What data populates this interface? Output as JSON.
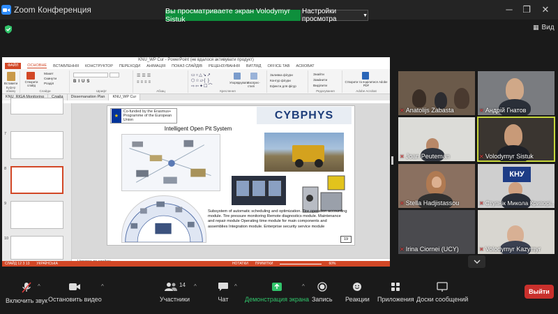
{
  "window": {
    "title": "Zoom Конференция"
  },
  "share_banner": {
    "text": "Вы просматриваете экран Volodymyr Sistuk",
    "view_options": "Настройки просмотра"
  },
  "view_button": "Вид",
  "ppt": {
    "window_title": "KNU_WP Cur - PowerPoint (не вдалося активувати продукт)",
    "tabs": [
      "ФАЙЛ",
      "ОСНОВНЕ",
      "ВСТАВЛЕННЯ",
      "КОНСТРУКТОР",
      "ПЕРЕХОДИ",
      "АНІМАЦІЯ",
      "ПОКАЗ СЛАЙДІВ",
      "РЕЦЕНЗУВАННЯ",
      "ВИГЛЯД",
      "OFFICE TAB",
      "ACROBAT"
    ],
    "ribbon": {
      "paste": "Вставити",
      "clipboard": "Буфер обміну",
      "new_slide": "Створити слайд",
      "slides": "Слайди",
      "layout": "Макет",
      "reset": "Скинути",
      "section": "Розділ",
      "font": "Шрифт",
      "paragraph": "Абзац",
      "arrange": "Упорядкувати",
      "quick_styles": "Експрес-стилі",
      "drawing": "Креслення",
      "fill": "Заливка фігури",
      "outline": "Контур фігури",
      "effects": "Ефекти для фігур",
      "find": "Знайти",
      "replace": "Замінити",
      "select": "Виділити",
      "editing": "Редагування",
      "adobe": "Створити та поділитися Adobe PDF",
      "adobe_group": "Adobe Acrobat"
    },
    "doc_tabs": [
      "KNU_RIGA Monitoring",
      "Слайд",
      "Dissemanation Plan",
      "KNU_WP Cur"
    ],
    "thumb_numbers": [
      "7",
      "8",
      "9",
      "10"
    ],
    "slide": {
      "eu_text": "Co-funded by the Erasmus+ Programme of the European Union",
      "logo": "CYBPHYS",
      "title": "Intelligent Open Pit System",
      "description": "Subsystem of automatic scheduling and optimization. Tire operation accounting module. Tire pressure monitoring Remote diagnostics module. Maintenance and repair module Operating time module for main components and assemblies Integration module. Enterprise security service module",
      "page_number": "19"
    },
    "notes": "Нотатки до слайда",
    "status": {
      "slide": "СЛАЙД 12 З 13",
      "lang": "УКРАЇНСЬКА",
      "notes": "НОТАТКИ",
      "comments": "ПРИМІТКИ",
      "zoom": "60%"
    }
  },
  "gallery": [
    {
      "name": "Anatolijs Zabasta"
    },
    {
      "name": "Андрій Гнатов"
    },
    {
      "name": "Joan Peuteman"
    },
    {
      "name": "Volodymyr Sistuk"
    },
    {
      "name": "Stella Hadjistassou"
    },
    {
      "name": "Ступнік Микола Криворі..."
    },
    {
      "name": "Irina Ciornei (UCY)"
    },
    {
      "name": "Volodymyr Kazymyr"
    }
  ],
  "toolbar": {
    "mute": "Включить звук",
    "video": "Остановить видео",
    "participants": "Участники",
    "participants_count": "14",
    "chat": "Чат",
    "share": "Демонстрация экрана",
    "record": "Запись",
    "reactions": "Реакции",
    "apps": "Приложения",
    "whiteboard": "Доски сообщений",
    "leave": "Выйти"
  }
}
